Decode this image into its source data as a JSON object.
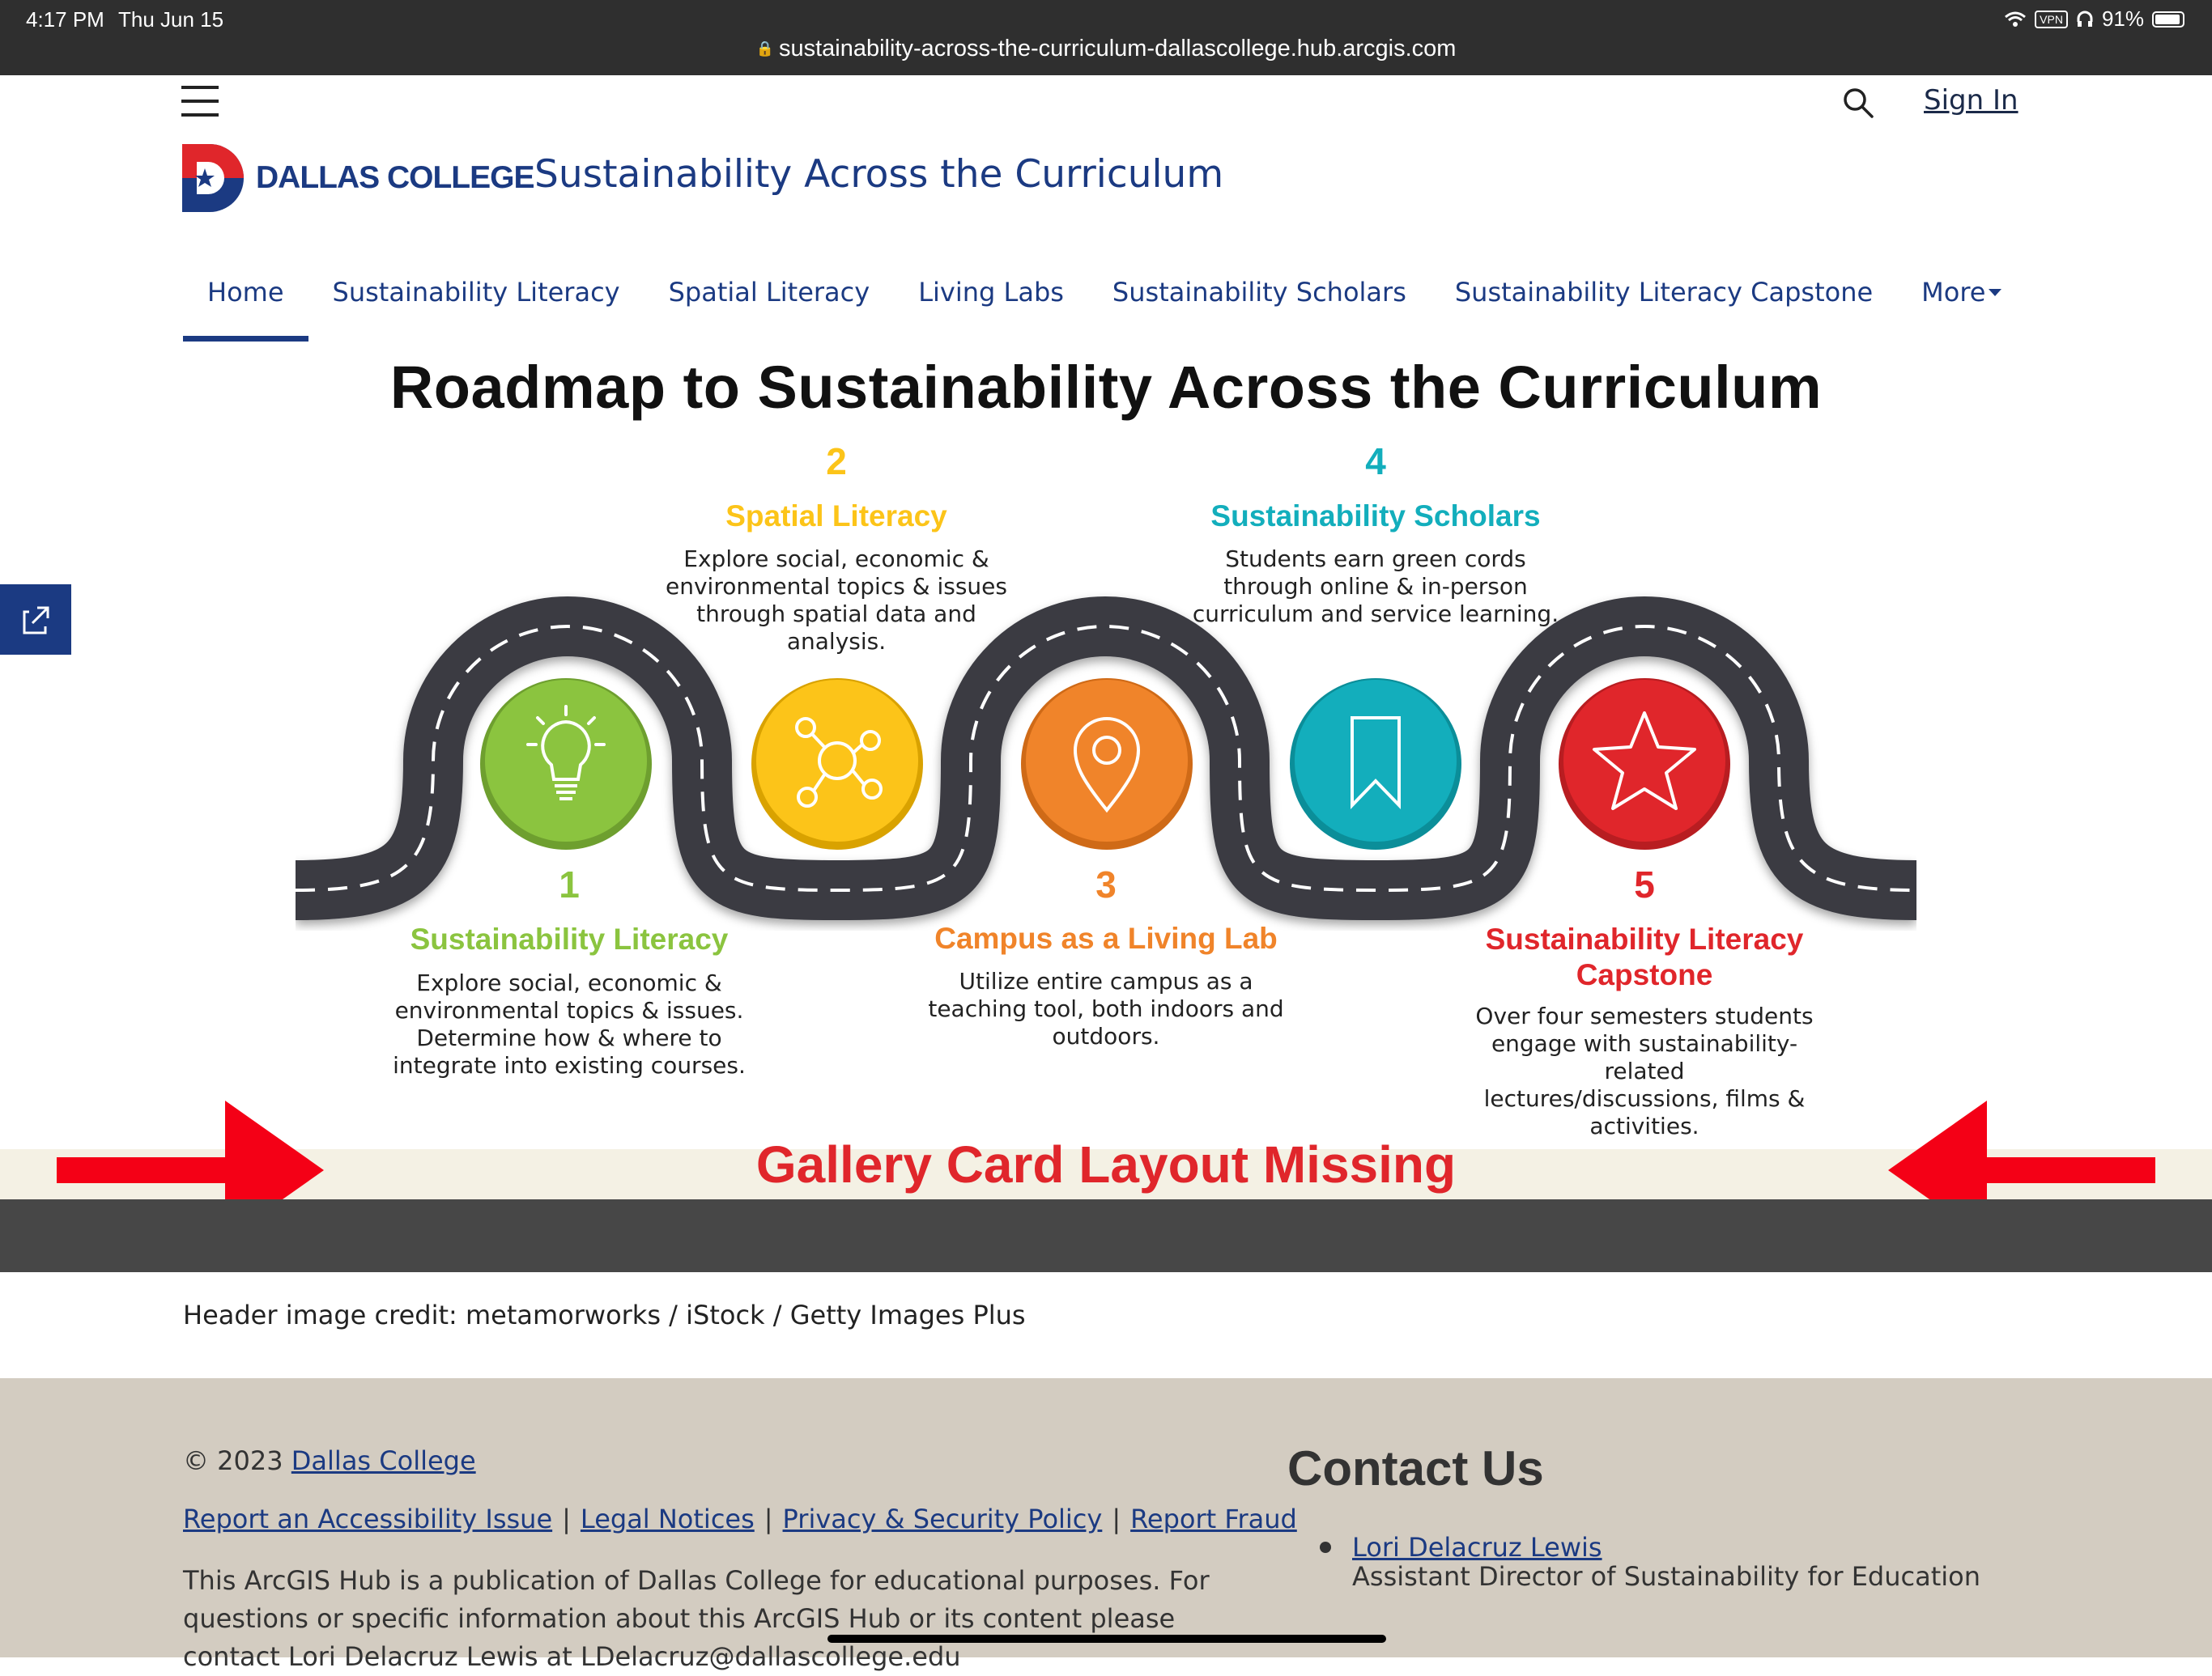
{
  "status_bar": {
    "time": "4:17 PM",
    "date": "Thu Jun 15",
    "vpn": "VPN",
    "battery": "91%",
    "url": "sustainability-across-the-curriculum-dallascollege.hub.arcgis.com"
  },
  "header": {
    "logo_text": "DALLAS COLLEGE",
    "site_title": "Sustainability Across the Curriculum",
    "sign_in": "Sign In"
  },
  "nav": {
    "items": [
      {
        "label": "Home",
        "active": true
      },
      {
        "label": "Sustainability Literacy"
      },
      {
        "label": "Spatial Literacy"
      },
      {
        "label": "Living Labs"
      },
      {
        "label": "Sustainability Scholars"
      },
      {
        "label": "Sustainability Literacy Capstone"
      },
      {
        "label": "More"
      }
    ]
  },
  "roadmap": {
    "title": "Roadmap to Sustainability Across the Curriculum",
    "steps": [
      {
        "num": "1",
        "title": "Sustainability Literacy",
        "color": "#8bc43f",
        "desc": [
          "Explore social, economic &",
          "environmental topics & issues.",
          "Determine how & where to",
          "integrate into existing courses."
        ]
      },
      {
        "num": "2",
        "title": "Spatial Literacy",
        "color": "#fcc419",
        "desc": [
          "Explore social, economic &",
          "environmental topics & issues",
          "through spatial data and analysis."
        ]
      },
      {
        "num": "3",
        "title": "Campus as a Living Lab",
        "color": "#f0842a",
        "desc": [
          "Utilize entire campus as a",
          "teaching tool, both indoors and",
          "outdoors."
        ]
      },
      {
        "num": "4",
        "title": "Sustainability Scholars",
        "color": "#13aebc",
        "desc": [
          "Students earn green cords",
          "through online & in-person",
          "curriculum and service learning."
        ]
      },
      {
        "num": "5",
        "title": "Sustainability Literacy Capstone",
        "title_lines": [
          "Sustainability Literacy",
          "Capstone"
        ],
        "color": "#e0262b",
        "desc": [
          "Over four semesters students",
          "engage with sustainability-related",
          "lectures/discussions, films &",
          "activities."
        ]
      }
    ]
  },
  "banner": {
    "text": "Gallery Card Layout Missing",
    "color": "#e0262b"
  },
  "credit": "Header image credit: metamorworks / iStock / Getty Images Plus",
  "footer": {
    "copyright_prefix": "© 2023",
    "copyright_link": "Dallas College",
    "links": [
      "Report an Accessibility Issue",
      "Legal Notices",
      "Privacy & Security Policy",
      "Report Fraud"
    ],
    "publication_text": "This ArcGIS Hub is a publication of Dallas College for educational purposes. For questions or specific information about this ArcGIS Hub or its content please contact Lori Delacruz Lewis at LDelacruz@dallascollege.edu",
    "contact_heading": "Contact Us",
    "contact_name": "Lori Delacruz Lewis",
    "contact_role": "Assistant Director of Sustainability for Education"
  },
  "icons": {
    "menu": "hamburger-icon",
    "search": "search-icon",
    "share": "share-icon",
    "step1": "lightbulb-icon",
    "step2": "network-icon",
    "step3": "map-pin-icon",
    "step4": "bookmark-icon",
    "step5": "star-icon"
  }
}
